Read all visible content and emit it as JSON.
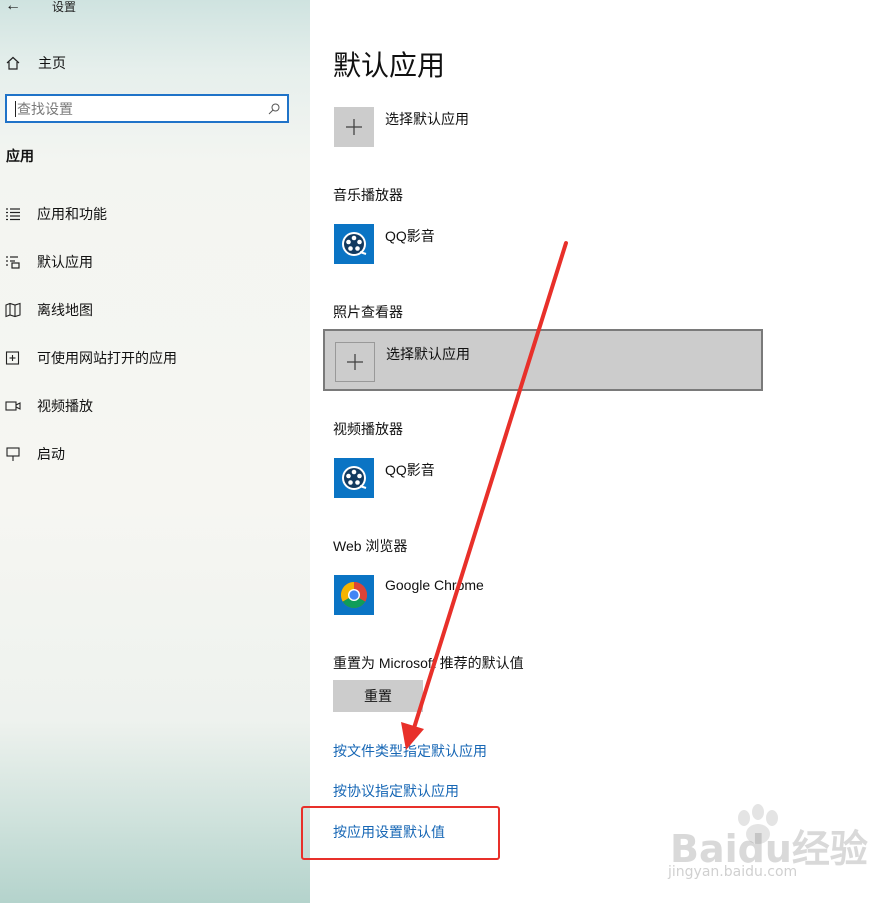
{
  "window": {
    "title": "设置"
  },
  "sidebar": {
    "home_label": "主页",
    "search_placeholder": "查找设置",
    "section_title": "应用",
    "items": [
      {
        "label": "应用和功能",
        "icon": "apps-features-icon"
      },
      {
        "label": "默认应用",
        "icon": "default-apps-icon"
      },
      {
        "label": "离线地图",
        "icon": "offline-maps-icon"
      },
      {
        "label": "可使用网站打开的应用",
        "icon": "apps-for-websites-icon"
      },
      {
        "label": "视频播放",
        "icon": "video-playback-icon"
      },
      {
        "label": "启动",
        "icon": "startup-icon"
      }
    ]
  },
  "main": {
    "title": "默认应用",
    "first_choice": "选择默认应用",
    "music_label": "音乐播放器",
    "music_app": "QQ影音",
    "photo_label": "照片查看器",
    "photo_choice": "选择默认应用",
    "video_label": "视频播放器",
    "video_app": "QQ影音",
    "web_label": "Web 浏览器",
    "web_app": "Google Chrome",
    "reset_label": "重置为 Microsoft 推荐的默认值",
    "reset_button": "重置",
    "links": [
      "按文件类型指定默认应用",
      "按协议指定默认应用",
      "按应用设置默认值"
    ]
  },
  "watermark": {
    "brand": "Baidu经验",
    "url": "jingyan.baidu.com"
  },
  "colors": {
    "accent": "#1f73c8",
    "link": "#1767b5",
    "annotation": "#e8302a",
    "tile": "#0a74c4"
  }
}
